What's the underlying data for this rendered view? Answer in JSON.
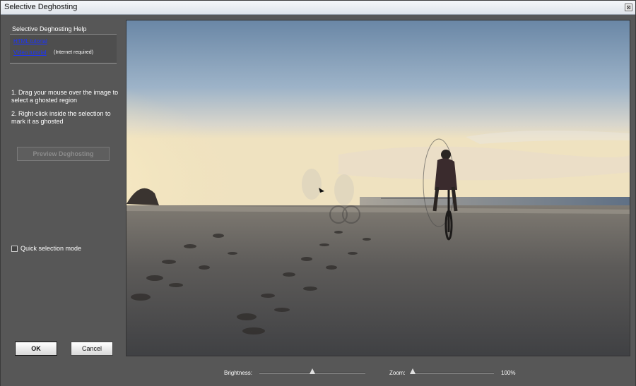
{
  "window": {
    "title": "Selective Deghosting",
    "close_glyph": "⊠"
  },
  "help": {
    "title": "Selective Deghosting Help",
    "html_tutorial": "HTML tutorial",
    "video_tutorial": "Video tutorial",
    "internet_note": "(Internet required)"
  },
  "instructions": {
    "step1": "1. Drag your  mouse over the image to select a ghosted region",
    "step2": "2. Right-click inside the selection to mark it as ghosted"
  },
  "buttons": {
    "preview": "Preview Deghosting",
    "ok": "OK",
    "cancel": "Cancel"
  },
  "quick_selection": {
    "label": "Quick selection mode",
    "checked": false
  },
  "controls": {
    "brightness_label": "Brightness:",
    "brightness_level": 0.5,
    "zoom_label": "Zoom:",
    "zoom_value": "100%",
    "zoom_level": 0.0
  },
  "image": {
    "subject": "cyclist on beach at sunset with ghosted figures"
  },
  "colors": {
    "link": "#1a33ff",
    "panel": "#575757",
    "sky_top": "#6f8dab",
    "sun": "#fff6d8"
  }
}
